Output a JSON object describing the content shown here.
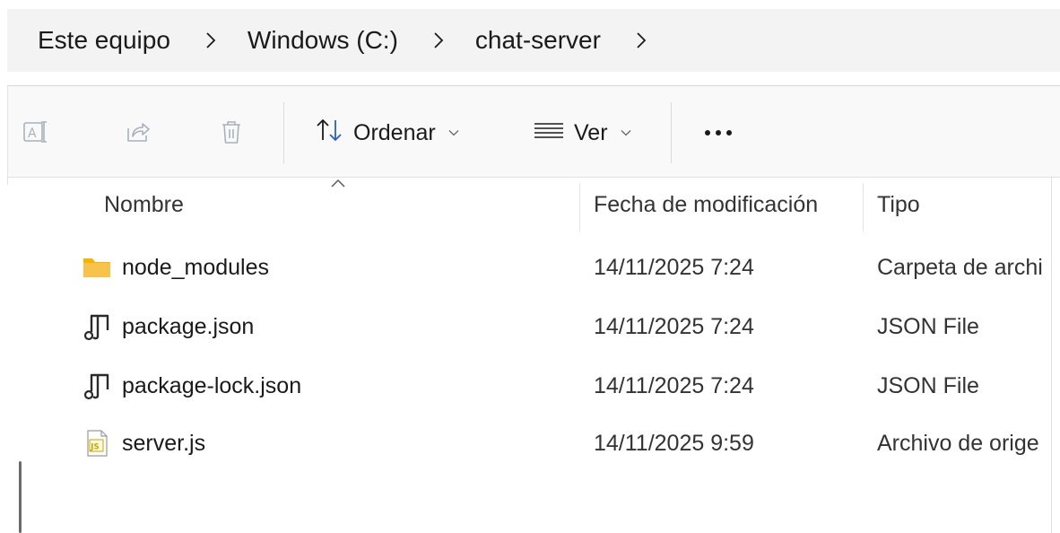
{
  "breadcrumb": {
    "items": [
      "Este equipo",
      "Windows (C:)",
      "chat-server"
    ],
    "separator_icon": "chevron-right-icon"
  },
  "toolbar": {
    "rename_icon": "rename-icon",
    "share_icon": "share-icon",
    "delete_icon": "trash-icon",
    "sort_label": "Ordenar",
    "view_label": "Ver",
    "more_icon": "more-options-icon"
  },
  "columns": {
    "name": "Nombre",
    "date": "Fecha de modificación",
    "type": "Tipo"
  },
  "files": [
    {
      "name": "node_modules",
      "date": "14/11/2025 7:24",
      "type": "Carpeta de archi",
      "icon": "folder-icon"
    },
    {
      "name": "package.json",
      "date": "14/11/2025 7:24",
      "type": "JSON File",
      "icon": "node-file-icon"
    },
    {
      "name": "package-lock.json",
      "date": "14/11/2025 7:24",
      "type": "JSON File",
      "icon": "node-file-icon"
    },
    {
      "name": "server.js",
      "date": "14/11/2025 9:59",
      "type": "Archivo de orige",
      "icon": "js-file-icon"
    }
  ],
  "colors": {
    "folder": "#f8c34a",
    "js_badge": "#c8a400",
    "disabled_icon": "#a9b1bb",
    "sort_icon": "#2b5fbf"
  }
}
